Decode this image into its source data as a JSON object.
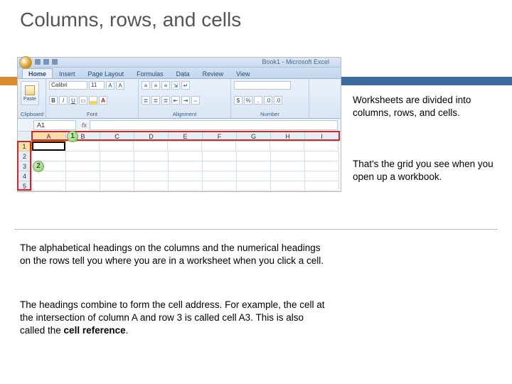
{
  "title": "Columns, rows, and cells",
  "side1": "Worksheets are divided into columns, rows, and cells.",
  "side2": "That's the grid you see when you open up a workbook.",
  "bottom1": "The alphabetical headings on the columns and the numerical headings on the rows tell you where you are in a worksheet when you click a cell.",
  "bottom2_a": "The headings combine to form the cell address. For example, the cell at the intersection of column A and row 3 is called cell A3. This is also called the ",
  "bottom2_b": "cell reference",
  "bottom2_c": ".",
  "excel": {
    "doc_title": "Book1 - Microsoft Excel",
    "tabs": [
      "Home",
      "Insert",
      "Page Layout",
      "Formulas",
      "Data",
      "Review",
      "View"
    ],
    "active_tab": 0,
    "groups": {
      "clipboard": "Clipboard",
      "font": "Font",
      "alignment": "Alignment",
      "number": "Number"
    },
    "paste_label": "Paste",
    "font_name": "Calibri",
    "font_size": "11",
    "name_box": "A1",
    "columns": [
      "A",
      "B",
      "C",
      "D",
      "E",
      "F",
      "G",
      "H",
      "I"
    ],
    "rows": [
      "1",
      "2",
      "3",
      "4",
      "5"
    ],
    "selected_col": 0,
    "selected_row": 0
  },
  "callouts": {
    "c1": "1",
    "c2": "2"
  }
}
